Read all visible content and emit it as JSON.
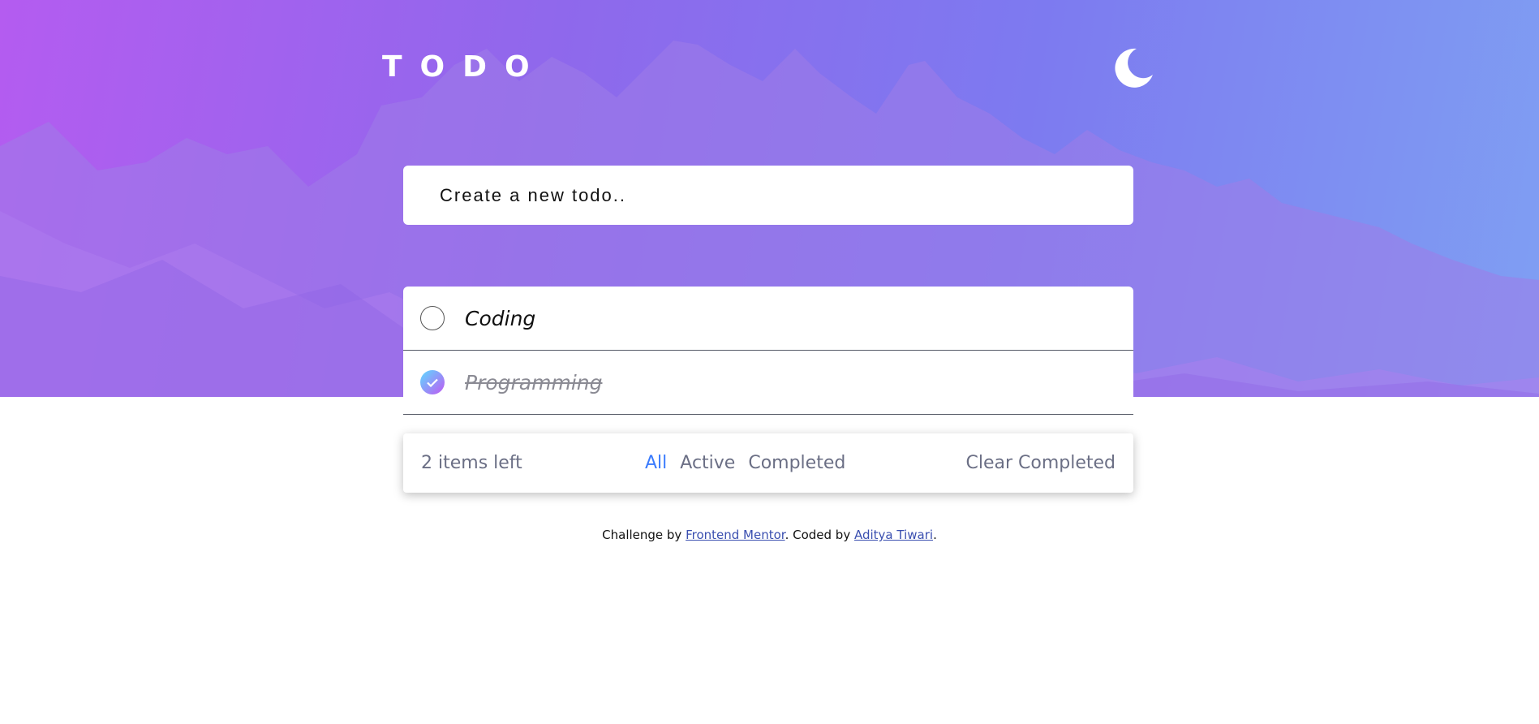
{
  "header": {
    "title": "TODO",
    "theme_icon": "moon-icon"
  },
  "new_todo": {
    "placeholder": "Create a new todo.."
  },
  "todos": [
    {
      "text": "Coding",
      "completed": false
    },
    {
      "text": "Programming",
      "completed": true
    }
  ],
  "footer": {
    "items_left": "2 items left",
    "filters": [
      "All",
      "Active",
      "Completed"
    ],
    "active_filter": "All",
    "clear_label": "Clear Completed"
  },
  "attribution": {
    "prefix": "Challenge by ",
    "link1": "Frontend Mentor",
    "middle": ". Coded by ",
    "link2": "Aditya Tiwari",
    "suffix": "."
  },
  "colors": {
    "accent": "#3a7bfd",
    "check_gradient_start": "#5ddbff",
    "check_gradient_end": "#c058f3",
    "muted_text": "#6b6f85"
  }
}
